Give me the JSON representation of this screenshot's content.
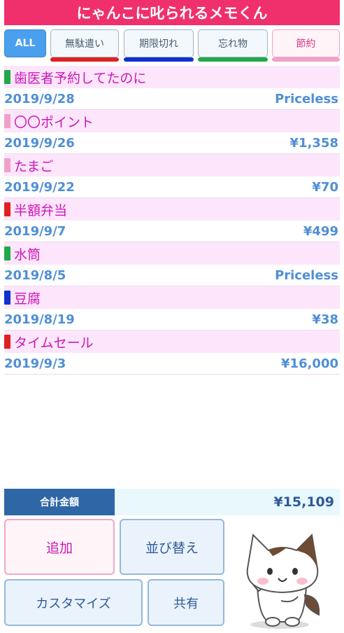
{
  "app": {
    "title": "にゃんこに叱られるメモくん"
  },
  "tabs": [
    {
      "label": "ALL",
      "color": "#4aa0ee"
    },
    {
      "label": "無駄遣い",
      "color": "#e02020"
    },
    {
      "label": "期限切れ",
      "color": "#1030d0"
    },
    {
      "label": "忘れ物",
      "color": "#21a84a"
    },
    {
      "label": "節約",
      "color": "#f1a0c8"
    }
  ],
  "items": [
    {
      "title": "歯医者予約してたのに",
      "date": "2019/9/28",
      "amount": "Priceless",
      "color": "#21a84a"
    },
    {
      "title": "〇〇ポイント",
      "date": "2019/9/26",
      "amount": "¥1,358",
      "color": "#f1a0c8"
    },
    {
      "title": "たまご",
      "date": "2019/9/22",
      "amount": "¥70",
      "color": "#f1a0c8"
    },
    {
      "title": "半額弁当",
      "date": "2019/9/7",
      "amount": "¥499",
      "color": "#e02020"
    },
    {
      "title": "水筒",
      "date": "2019/8/5",
      "amount": "Priceless",
      "color": "#21a84a"
    },
    {
      "title": "豆腐",
      "date": "2019/8/19",
      "amount": "¥38",
      "color": "#1030d0"
    },
    {
      "title": "タイムセール",
      "date": "2019/9/3",
      "amount": "¥16,000",
      "color": "#e02020"
    }
  ],
  "total": {
    "label": "合計金額",
    "amount": "¥15,109"
  },
  "buttons": {
    "add": "追加",
    "sort": "並び替え",
    "customize": "カスタマイズ",
    "share": "共有"
  },
  "mascot": {
    "icon": "cat-mascot"
  }
}
